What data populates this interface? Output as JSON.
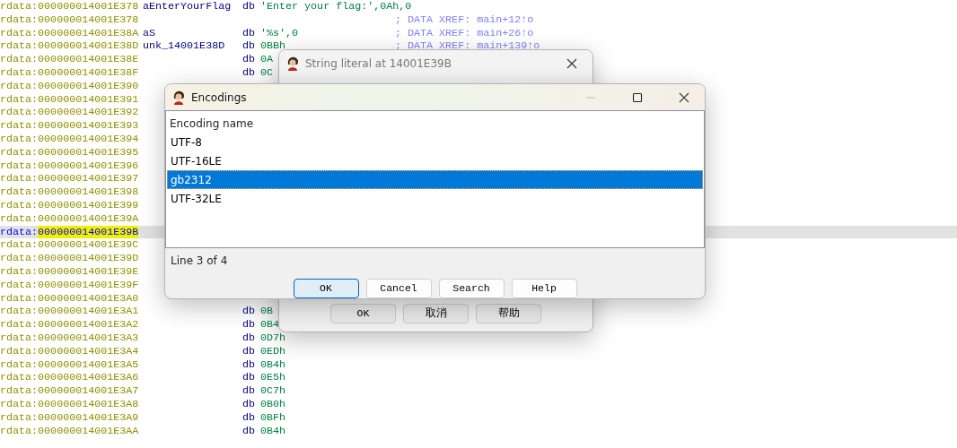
{
  "listing": {
    "rows": [
      {
        "segment": "rdata:",
        "address": "000000014001E378",
        "label": "aEnterYourFlag",
        "instruction": "db",
        "operand": "'Enter your flag:',0Ah,0",
        "selected": false
      },
      {
        "segment": "rdata:",
        "address": "000000014001E378",
        "comment": "; DATA XREF: main+12↑o",
        "selected": false
      },
      {
        "segment": "rdata:",
        "address": "000000014001E38A",
        "label": "aS",
        "instruction": "db",
        "operand": "'%s',0",
        "comment": "; DATA XREF: main+26↑o",
        "selected": false
      },
      {
        "segment": "rdata:",
        "address": "000000014001E38D",
        "label": "unk_14001E38D",
        "instruction": "db",
        "operand": "0BBh",
        "comment": "; DATA XREF: main+139↑o",
        "selected": false
      },
      {
        "segment": "rdata:",
        "address": "000000014001E38E",
        "instruction": "db",
        "operand": "0A",
        "selected": false
      },
      {
        "segment": "rdata:",
        "address": "000000014001E38F",
        "instruction": "db",
        "operand": "0C",
        "selected": false
      },
      {
        "segment": "rdata:",
        "address": "000000014001E390",
        "selected": false
      },
      {
        "segment": "rdata:",
        "address": "000000014001E391",
        "selected": false
      },
      {
        "segment": "rdata:",
        "address": "000000014001E392",
        "selected": false
      },
      {
        "segment": "rdata:",
        "address": "000000014001E393",
        "selected": false
      },
      {
        "segment": "rdata:",
        "address": "000000014001E394",
        "selected": false
      },
      {
        "segment": "rdata:",
        "address": "000000014001E395",
        "selected": false
      },
      {
        "segment": "rdata:",
        "address": "000000014001E396",
        "selected": false
      },
      {
        "segment": "rdata:",
        "address": "000000014001E397",
        "selected": false
      },
      {
        "segment": "rdata:",
        "address": "000000014001E398",
        "selected": false
      },
      {
        "segment": "rdata:",
        "address": "000000014001E399",
        "selected": false
      },
      {
        "segment": "rdata:",
        "address": "000000014001E39A",
        "selected": false
      },
      {
        "segment": "rdata:",
        "address": "000000014001E39B",
        "selected": true
      },
      {
        "segment": "rdata:",
        "address": "000000014001E39C",
        "selected": false
      },
      {
        "segment": "rdata:",
        "address": "000000014001E39D",
        "selected": false
      },
      {
        "segment": "rdata:",
        "address": "000000014001E39E",
        "selected": false
      },
      {
        "segment": "rdata:",
        "address": "000000014001E39F",
        "selected": false
      },
      {
        "segment": "rdata:",
        "address": "000000014001E3A0",
        "selected": false
      },
      {
        "segment": "rdata:",
        "address": "000000014001E3A1",
        "instruction": "db",
        "operand": "0B",
        "selected": false
      },
      {
        "segment": "rdata:",
        "address": "000000014001E3A2",
        "instruction": "db",
        "operand": "0B4",
        "selected": false
      },
      {
        "segment": "rdata:",
        "address": "000000014001E3A3",
        "instruction": "db",
        "operand": "0D7h",
        "selected": false
      },
      {
        "segment": "rdata:",
        "address": "000000014001E3A4",
        "instruction": "db",
        "operand": "0EDh",
        "selected": false
      },
      {
        "segment": "rdata:",
        "address": "000000014001E3A5",
        "instruction": "db",
        "operand": "0B4h",
        "selected": false
      },
      {
        "segment": "rdata:",
        "address": "000000014001E3A6",
        "instruction": "db",
        "operand": "0E5h",
        "selected": false
      },
      {
        "segment": "rdata:",
        "address": "000000014001E3A7",
        "instruction": "db",
        "operand": "0C7h",
        "selected": false
      },
      {
        "segment": "rdata:",
        "address": "000000014001E3A8",
        "instruction": "db",
        "operand": "0B0h",
        "selected": false
      },
      {
        "segment": "rdata:",
        "address": "000000014001E3A9",
        "instruction": "db",
        "operand": "0BFh",
        "selected": false
      },
      {
        "segment": "rdata:",
        "address": "000000014001E3AA",
        "instruction": "db",
        "operand": "0B4h",
        "selected": false
      }
    ]
  },
  "string_dialog": {
    "title": "String literal at 14001E39B",
    "buttons": [
      {
        "label": "OK"
      },
      {
        "label": "取消"
      },
      {
        "label": "帮助"
      }
    ]
  },
  "encodings_dialog": {
    "title": "Encodings",
    "column": "Encoding name",
    "items": [
      {
        "label": "UTF-8",
        "selected": false
      },
      {
        "label": "UTF-16LE",
        "selected": false
      },
      {
        "label": "gb2312",
        "selected": true
      },
      {
        "label": "UTF-32LE",
        "selected": false
      }
    ],
    "status": "Line 3 of 4",
    "buttons": [
      {
        "label": "OK",
        "default": true
      },
      {
        "label": "Cancel",
        "default": false
      },
      {
        "label": "Search",
        "default": false
      },
      {
        "label": "Help",
        "default": false
      }
    ]
  }
}
